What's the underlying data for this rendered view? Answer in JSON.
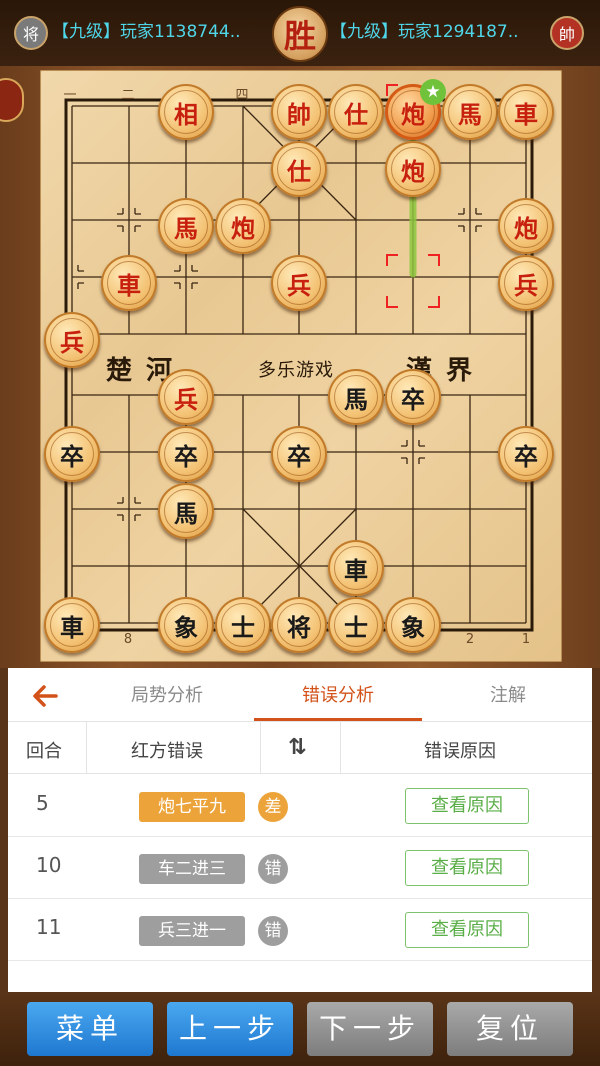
{
  "header": {
    "left_player": {
      "avatar_char": "将",
      "name": "【九级】玩家1138744..",
      "avatar_color": "#8a8a8a"
    },
    "result_badge": "胜",
    "right_player": {
      "avatar_char": "帥",
      "name": "【九级】玩家1294187..",
      "avatar_color": "#c0392b"
    }
  },
  "board": {
    "file_numbers_top": [
      "一",
      "二",
      "四"
    ],
    "file_numbers_bottom": [
      "8",
      "2",
      "1"
    ],
    "river_left": "楚河",
    "river_right": "漢界",
    "river_brand": "多乐游戏",
    "pieces": {
      "r1": "相",
      "r2": "帥",
      "r3": "仕",
      "r4": "炮",
      "r5": "馬",
      "r6": "車",
      "r7": "仕",
      "r8": "炮",
      "r9": "馬",
      "r10": "炮",
      "r11": "炮",
      "r12": "車",
      "r13": "兵",
      "r14": "兵",
      "r15": "兵",
      "r16": "兵",
      "b1": "馬",
      "b2": "卒",
      "b3": "卒",
      "b4": "卒",
      "b5": "卒",
      "b6": "卒",
      "b7": "馬",
      "b8": "車",
      "b9": "車",
      "b10": "象",
      "b11": "士",
      "b12": "将",
      "b13": "士",
      "b14": "象"
    }
  },
  "panel": {
    "tabs": [
      "局势分析",
      "错误分析",
      "注解"
    ],
    "active_tab": "错误分析",
    "columns": {
      "round": "回合",
      "side": "红方错误",
      "reason": "错误原因"
    },
    "rows": [
      {
        "round": "5",
        "move": "炮七平九",
        "grade": "差",
        "button": "查看原因",
        "tag_color": "#eca43a",
        "grade_color": "#eca43a"
      },
      {
        "round": "10",
        "move": "车二进三",
        "grade": "错",
        "button": "查看原因",
        "tag_color": "#9e9e9e",
        "grade_color": "#9e9e9e"
      },
      {
        "round": "11",
        "move": "兵三进一",
        "grade": "错",
        "button": "查看原因",
        "tag_color": "#9e9e9e",
        "grade_color": "#9e9e9e"
      }
    ]
  },
  "bottom": {
    "menu": "菜单",
    "prev": "上一步",
    "next": "下一步",
    "reset": "复位"
  },
  "colors": {
    "accent": "#d2521a",
    "blue_button": "#2f8fe0",
    "grey_button": "#8d8d8d",
    "green_button": "#5aae47"
  }
}
